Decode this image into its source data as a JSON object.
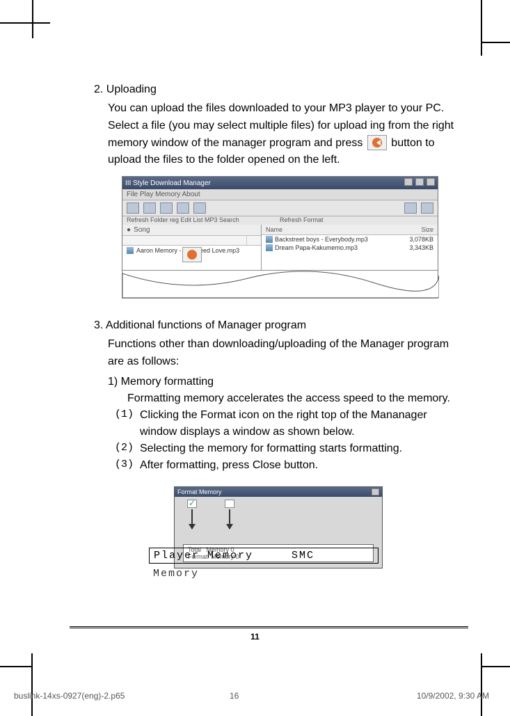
{
  "section2": {
    "title": "2. Uploading",
    "p1": "You can upload the files downloaded to your MP3 player to your PC. Select a file (you may select multiple files) for upload ing from  the right memory window of the manager program and press ",
    "p2": "button to upload the files to the folder opened on the left."
  },
  "manager_window": {
    "title": "III Style Download Manager",
    "menu": "File  Play  Memory  About",
    "left_tool_labels": "Refresh   Folder reg   Edit   List   MP3 Search",
    "right_tool_labels": "Refresh    Format",
    "left_combo": "Song",
    "right_header_name": "Name",
    "right_header_size": "Size",
    "left_file": "Aaron Memory - You Need Love.mp3",
    "right_files": [
      {
        "name": "Backstreet boys - Everybody.mp3",
        "size": "3,078KB"
      },
      {
        "name": "Dream Papa-Kakumemo.mp3",
        "size": "3,343KB"
      }
    ]
  },
  "section3": {
    "title": "3. Additional functions of Manager program",
    "intro": "Functions other than downloading/uploading of the Manager program are as follows:",
    "item1_title": "1)   Memory formatting",
    "item1_body": "Formatting memory accelerates the access speed to the memory.",
    "steps": [
      {
        "num": "(1)",
        "text": "Clicking the Format icon on the right top of the Mananager window displays a window as shown below."
      },
      {
        "num": "(2)",
        "text": "Selecting the memory for formatting starts formatting."
      },
      {
        "num": "(3)",
        "text": " After formatting, press Close button."
      }
    ]
  },
  "format_window": {
    "title": "Format Memory",
    "field_text": "Total   Memory 0\nFormat  Memory 0",
    "callout1": "Player Memory     SMC",
    "callout2": "Memory"
  },
  "page_number": "11",
  "footer": {
    "left": "buslink-14xs-0927(eng)-2.p65",
    "mid": "16",
    "right": "10/9/2002, 9:30 AM"
  }
}
